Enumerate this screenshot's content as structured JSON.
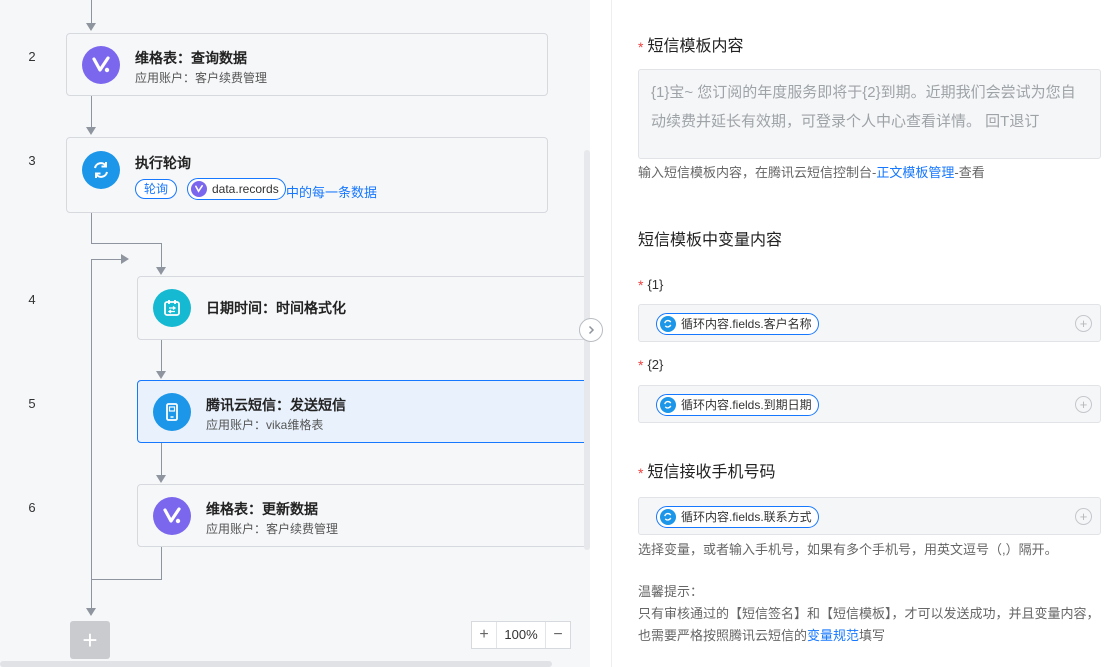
{
  "canvas": {
    "steps": [
      {
        "num": "2",
        "title": "维格表：查询数据",
        "sub": "应用账户：客户续费管理",
        "icon": "vika-icon"
      },
      {
        "num": "3",
        "title": "执行轮询",
        "icon": "loop-icon"
      },
      {
        "num": "4",
        "title": "日期时间：时间格式化",
        "icon": "calendar-icon"
      },
      {
        "num": "5",
        "title": "腾讯云短信：发送短信",
        "sub": "应用账户：vika维格表",
        "icon": "sms-icon"
      },
      {
        "num": "6",
        "title": "维格表：更新数据",
        "sub": "应用账户：客户续费管理",
        "icon": "vika-icon"
      }
    ],
    "loop_tag": "轮询",
    "loop_var": "data.records",
    "loop_suffix": "中的每一条数据",
    "zoom": {
      "minus": "−",
      "plus": "+",
      "value": "100%"
    },
    "add_label": "+"
  },
  "panel": {
    "template_title": "短信模板内容",
    "template_value": "{1}宝~ 您订阅的年度服务即将于{2}到期。近期我们会尝试为您自动续费并延长有效期，可登录个人中心查看详情。 回T退订",
    "template_hint_pre": "输入短信模板内容，在腾讯云短信控制台-",
    "template_hint_link": "正文模板管理",
    "template_hint_post": "-查看",
    "vars_title": "短信模板中变量内容",
    "var1_label": "{1}",
    "var1_value": "循环内容.fields.客户名称",
    "var2_label": "{2}",
    "var2_value": "循环内容.fields.到期日期",
    "phone_title": "短信接收手机号码",
    "phone_value": "循环内容.fields.联系方式",
    "phone_hint": "选择变量，或者输入手机号，如果有多个手机号，用英文逗号（,）隔开。",
    "tip_title": "温馨提示：",
    "tip_pre": "只有审核通过的【短信签名】和【短信模板】，才可以发送成功，并且变量内容，也需要严格按照腾讯云短信的",
    "tip_link": "变量规范",
    "tip_post": "填写",
    "required_mark": "*",
    "plus": "+"
  },
  "colors": {
    "accent": "#1677ff",
    "vika": "#7b67ee",
    "loop": "#1b96e8",
    "date": "#15b9d1",
    "required": "#f04040"
  }
}
